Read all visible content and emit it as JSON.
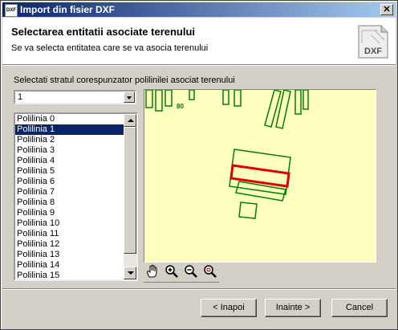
{
  "window": {
    "title": "Import din fisier DXF",
    "icon_text": "DXF"
  },
  "header": {
    "title": "Selectarea entitatii asociate terenului",
    "subtitle": "Se va selecta entitatea care se va asocia terenului",
    "icon_text": "DXF"
  },
  "layer": {
    "label": "Selectati stratul corespunzator polilinilei asociat terenului",
    "selected": "1"
  },
  "list": {
    "items": [
      "Polilinia 0",
      "Polilinia 1",
      "Polilinia 2",
      "Polilinia 3",
      "Polilinia 4",
      "Polilinia 5",
      "Polilinia 6",
      "Polilinia 7",
      "Polilinia 8",
      "Polilinia 9",
      "Polilinia 10",
      "Polilinia 11",
      "Polilinia 12",
      "Polilinia 13",
      "Polilinia 14",
      "Polilinia 15"
    ],
    "selected_index": 1
  },
  "preview": {
    "background": "#ffffc0",
    "line_color": "#008000",
    "highlight_color": "#e00000",
    "label": "80"
  },
  "toolbar": {
    "tools": [
      "pan-icon",
      "zoom-in-icon",
      "zoom-out-icon",
      "zoom-extents-icon"
    ]
  },
  "buttons": {
    "back": "< Inapoi",
    "next": "Inainte >",
    "cancel": "Cancel"
  }
}
